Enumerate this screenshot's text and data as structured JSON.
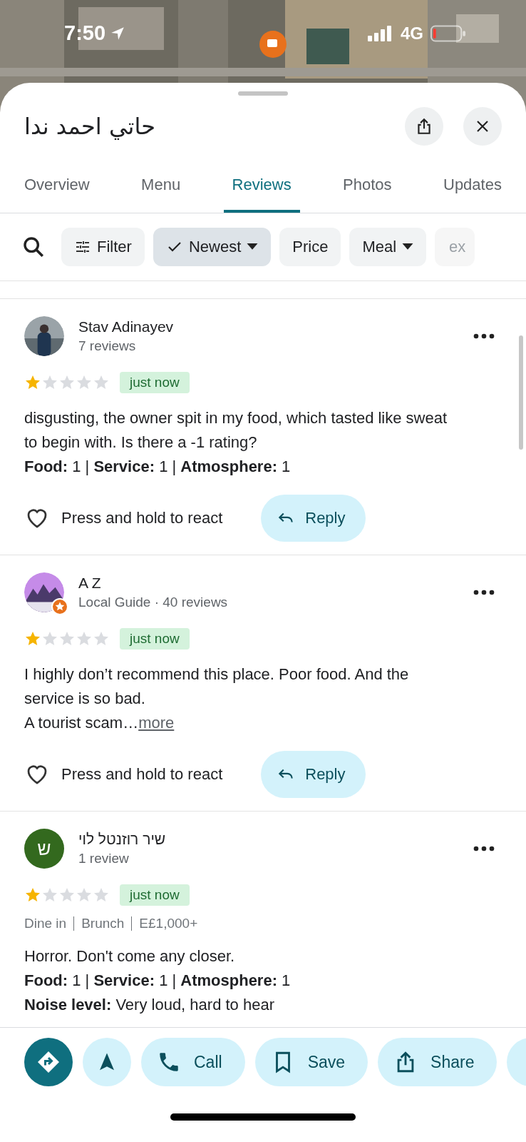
{
  "status_bar": {
    "time": "7:50",
    "network": "4G"
  },
  "place": {
    "title": "حاتي احمد ندا"
  },
  "tabs": [
    {
      "label": "Overview",
      "selected": false
    },
    {
      "label": "Menu",
      "selected": false
    },
    {
      "label": "Reviews",
      "selected": true
    },
    {
      "label": "Photos",
      "selected": false
    },
    {
      "label": "Updates",
      "selected": false
    }
  ],
  "chips": [
    {
      "kind": "filter",
      "label": "Filter",
      "selected": false
    },
    {
      "kind": "dropdown",
      "label": "Newest",
      "selected": true
    },
    {
      "kind": "plain",
      "label": "Price",
      "selected": false
    },
    {
      "kind": "dropdown",
      "label": "Meal",
      "selected": false
    },
    {
      "kind": "faded",
      "label": "ex",
      "selected": false
    }
  ],
  "reviews": [
    {
      "author": "Stav Adinayev",
      "meta": "7 reviews",
      "local_guide": false,
      "stars": 1,
      "time": "just now",
      "text": [
        "disgusting, the owner spit in my food, which tasted like sweat to begin with. Is there a -1 rating?",
        "**Food:** 1 | **Service:** 1 | **Atmosphere:** 1"
      ],
      "react": "Press and hold to react",
      "reply": "Reply"
    },
    {
      "author": "A Z",
      "meta": "Local Guide · 40 reviews",
      "local_guide": true,
      "stars": 1,
      "time": "just now",
      "text": [
        "I highly don’t recommend this place. Poor food. And the service is so bad.",
        "A tourist scam…"
      ],
      "more_link": "more",
      "react": "Press and hold to react",
      "reply": "Reply"
    },
    {
      "avatar_letter": "ש",
      "author": "שיר רוזנטל לוי",
      "meta": "1 review",
      "local_guide": false,
      "stars": 1,
      "time": "just now",
      "details": [
        "Dine in",
        "Brunch",
        "E£1,000+"
      ],
      "text": [
        "Horror. Don't come any closer.",
        "**Food:** 1 | **Service:** 1 | **Atmosphere:** 1",
        "**Noise level:** Very loud, hard to hear"
      ]
    }
  ],
  "actions": [
    {
      "kind": "directions"
    },
    {
      "kind": "start"
    },
    {
      "kind": "call",
      "label": "Call"
    },
    {
      "kind": "save",
      "label": "Save"
    },
    {
      "kind": "share",
      "label": "Share"
    },
    {
      "kind": "edge"
    }
  ]
}
